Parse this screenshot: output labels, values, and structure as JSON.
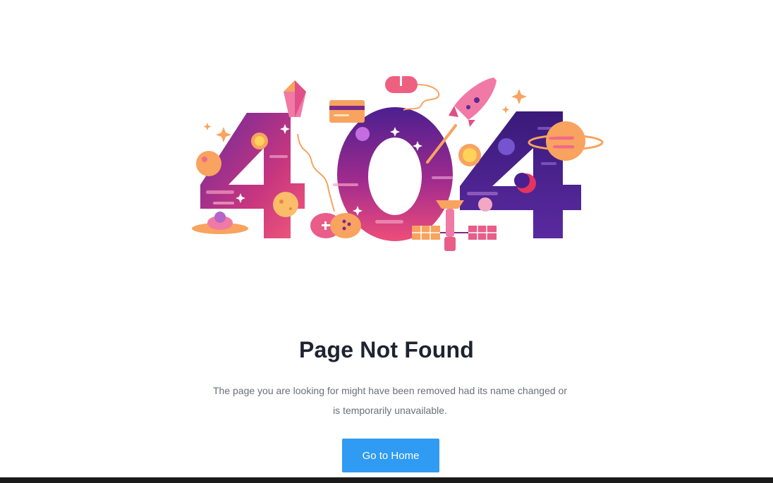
{
  "error": {
    "code_art": "404",
    "title": "Page Not Found",
    "message": "The page you are looking for might have been removed had its name changed or is temporarily unavailable.",
    "home_button_label": "Go to Home"
  },
  "colors": {
    "accent": "#2f9bf2",
    "title": "#1f2330",
    "message": "#6b6f7a",
    "art_purple": "#4b1f8f",
    "art_magenta": "#d4307a",
    "art_orange": "#f5a35a",
    "art_pink": "#ee6b9b"
  }
}
